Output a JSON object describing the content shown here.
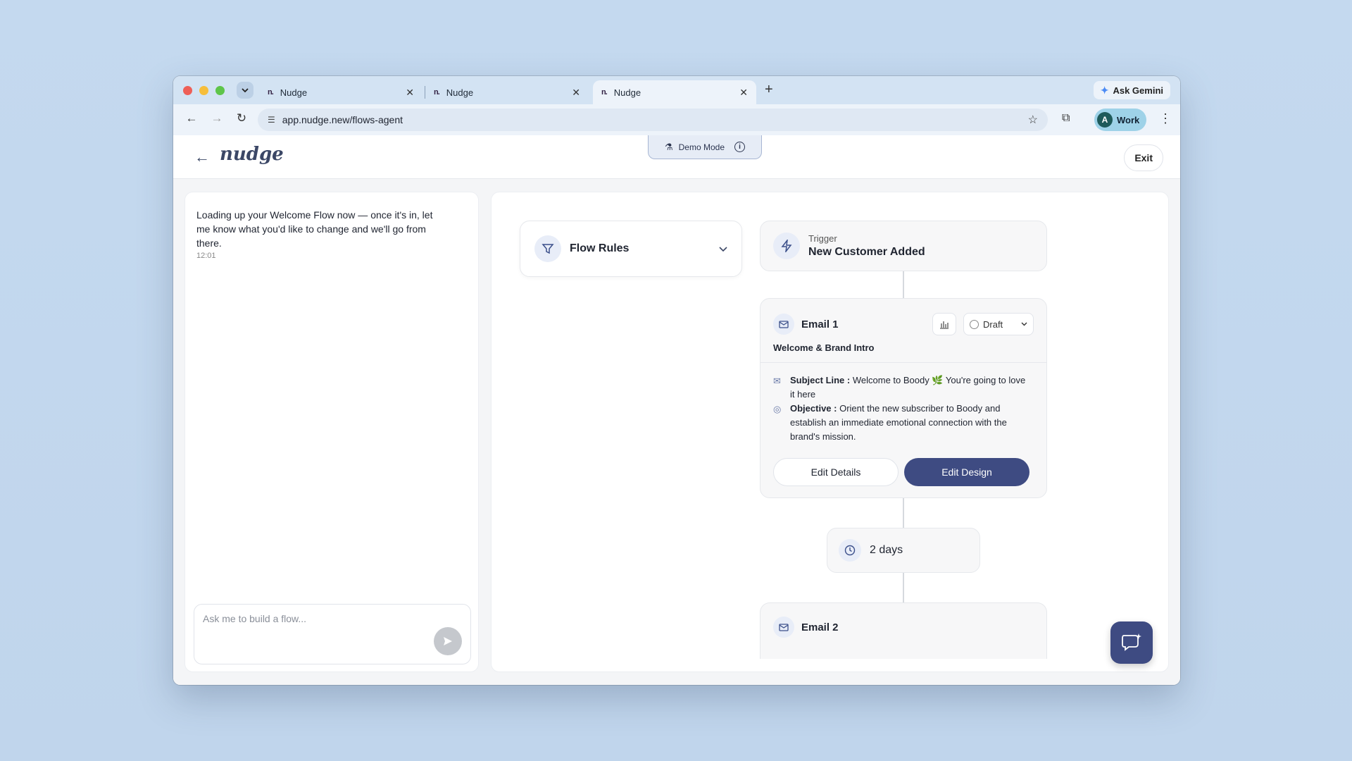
{
  "browser": {
    "tabs": [
      {
        "favicon": "n.",
        "label": "Nudge",
        "active": false
      },
      {
        "favicon": "n.",
        "label": "Nudge",
        "active": false
      },
      {
        "favicon": "n.",
        "label": "Nudge",
        "active": true
      }
    ],
    "new_tab_label": "+",
    "gemini_label": "Ask Gemini",
    "url": "app.nudge.new/flows-agent",
    "profile": {
      "initial": "A",
      "label": "Work"
    }
  },
  "app": {
    "logo": "nudge",
    "demo_mode_label": "Demo Mode",
    "exit_label": "Exit"
  },
  "chat": {
    "message": "Loading up your Welcome Flow now — once it's in, let me know what you'd like to change and we'll go from there.",
    "time": "12:01",
    "input_placeholder": "Ask me to build a flow..."
  },
  "flow": {
    "rules_label": "Flow Rules",
    "trigger": {
      "label": "Trigger",
      "value": "New Customer Added"
    },
    "email1": {
      "title": "Email 1",
      "status": "Draft",
      "subtitle": "Welcome & Brand Intro",
      "subject_label": "Subject Line :",
      "subject_value": "Welcome to Boody 🌿 You're going to love it here",
      "objective_label": "Objective :",
      "objective_value": "Orient the new subscriber to Boody and establish an immediate emotional connection with the brand's mission.",
      "edit_details_label": "Edit Details",
      "edit_design_label": "Edit Design"
    },
    "delay": {
      "label": "2 days"
    },
    "email2": {
      "title": "Email 2"
    }
  },
  "colors": {
    "accent": "#3e4b82",
    "background": "#c4d9ef"
  },
  "icons": {
    "flow_rules": "filter-icon",
    "trigger": "lightning-icon",
    "email": "mail-icon",
    "delay": "clock-icon",
    "help": "chat-sparkle-icon"
  }
}
